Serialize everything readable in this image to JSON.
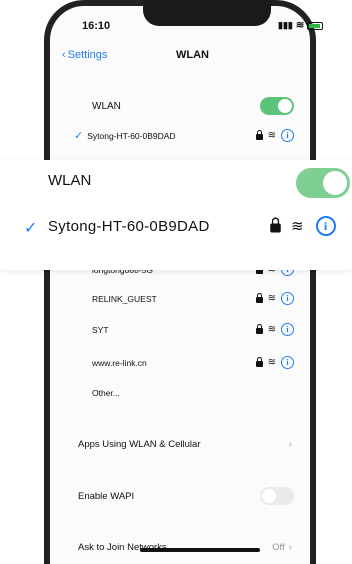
{
  "status_bar": {
    "time": "16:10"
  },
  "nav": {
    "back_label": "Settings",
    "title": "WLAN"
  },
  "wlan_row": {
    "label": "WLAN",
    "enabled": true
  },
  "connected": {
    "name": "Sytong-HT-60-0B9DAD"
  },
  "popup": {
    "wlan_label": "WLAN",
    "network_name": "Sytong-HT-60-0B9DAD"
  },
  "networks": [
    {
      "name": "longtong888-5G"
    },
    {
      "name": "RELINK_GUEST"
    },
    {
      "name": "SYT"
    },
    {
      "name": "www.re-link.cn"
    }
  ],
  "other_label": "Other...",
  "apps_using": {
    "label": "Apps Using WLAN & Cellular"
  },
  "enable_wapi": {
    "label": "Enable WAPI",
    "enabled": false
  },
  "ask_to_join": {
    "label": "Ask to Join Networks",
    "value": "Off"
  },
  "colors": {
    "accent": "#1e7cf2",
    "toggle_on": "#5cc47a"
  },
  "icons": [
    "chevron-left-icon",
    "lock-icon",
    "wifi-icon",
    "info-icon",
    "checkmark-icon",
    "battery-icon",
    "signal-icon"
  ]
}
